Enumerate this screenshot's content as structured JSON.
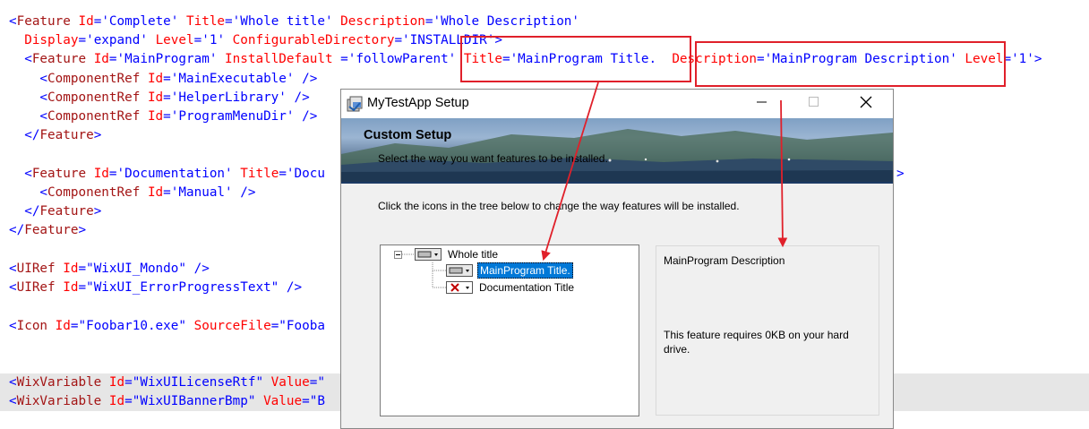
{
  "code": {
    "lines": [
      [
        [
          "punc",
          "<"
        ],
        [
          "elem",
          "Feature"
        ],
        [
          "punc",
          " "
        ],
        [
          "attr",
          "Id"
        ],
        [
          "punc",
          "="
        ],
        [
          "val",
          "'Complete'"
        ],
        [
          "punc",
          " "
        ],
        [
          "attr",
          "Title"
        ],
        [
          "punc",
          "="
        ],
        [
          "val",
          "'Whole title'"
        ],
        [
          "punc",
          " "
        ],
        [
          "attr",
          "Description"
        ],
        [
          "punc",
          "="
        ],
        [
          "val",
          "'Whole Description'"
        ]
      ],
      [
        [
          "punc",
          "  "
        ],
        [
          "attr",
          "Display"
        ],
        [
          "punc",
          "="
        ],
        [
          "val",
          "'expand'"
        ],
        [
          "punc",
          " "
        ],
        [
          "attr",
          "Level"
        ],
        [
          "punc",
          "="
        ],
        [
          "val",
          "'1'"
        ],
        [
          "punc",
          " "
        ],
        [
          "attr",
          "ConfigurableDirectory"
        ],
        [
          "punc",
          "="
        ],
        [
          "val",
          "'INSTALLDIR'"
        ],
        [
          "punc",
          ">"
        ]
      ],
      [
        [
          "punc",
          "  <"
        ],
        [
          "elem",
          "Feature"
        ],
        [
          "punc",
          " "
        ],
        [
          "attr",
          "Id"
        ],
        [
          "punc",
          "="
        ],
        [
          "val",
          "'MainProgram'"
        ],
        [
          "punc",
          " "
        ],
        [
          "attr",
          "InstallDefault"
        ],
        [
          "punc",
          " ="
        ],
        [
          "val",
          "'followParent'"
        ],
        [
          "punc",
          " "
        ],
        [
          "attr",
          "Title"
        ],
        [
          "punc",
          "="
        ],
        [
          "val",
          "'MainProgram Title."
        ],
        [
          "punc",
          "  "
        ],
        [
          "attr",
          "Description"
        ],
        [
          "punc",
          "="
        ],
        [
          "val",
          "'MainProgram Description'"
        ],
        [
          "punc",
          " "
        ],
        [
          "attr",
          "Level"
        ],
        [
          "punc",
          "="
        ],
        [
          "val",
          "'1'"
        ],
        [
          "punc",
          ">"
        ]
      ],
      [
        [
          "punc",
          "    <"
        ],
        [
          "elem",
          "ComponentRef"
        ],
        [
          "punc",
          " "
        ],
        [
          "attr",
          "Id"
        ],
        [
          "punc",
          "="
        ],
        [
          "val",
          "'MainExecutable'"
        ],
        [
          "punc",
          " />"
        ]
      ],
      [
        [
          "punc",
          "    <"
        ],
        [
          "elem",
          "ComponentRef"
        ],
        [
          "punc",
          " "
        ],
        [
          "attr",
          "Id"
        ],
        [
          "punc",
          "="
        ],
        [
          "val",
          "'HelperLibrary'"
        ],
        [
          "punc",
          " />"
        ]
      ],
      [
        [
          "punc",
          "    <"
        ],
        [
          "elem",
          "ComponentRef"
        ],
        [
          "punc",
          " "
        ],
        [
          "attr",
          "Id"
        ],
        [
          "punc",
          "="
        ],
        [
          "val",
          "'ProgramMenuDir'"
        ],
        [
          "punc",
          " />"
        ]
      ],
      [
        [
          "punc",
          "  </"
        ],
        [
          "elem",
          "Feature"
        ],
        [
          "punc",
          ">"
        ]
      ],
      [],
      [
        [
          "punc",
          "  <"
        ],
        [
          "elem",
          "Feature"
        ],
        [
          "punc",
          " "
        ],
        [
          "attr",
          "Id"
        ],
        [
          "punc",
          "="
        ],
        [
          "val",
          "'Documentation'"
        ],
        [
          "punc",
          " "
        ],
        [
          "attr",
          "Title"
        ],
        [
          "punc",
          "="
        ],
        [
          "val",
          "'Docu"
        ]
      ],
      [
        [
          "punc",
          "    <"
        ],
        [
          "elem",
          "ComponentRef"
        ],
        [
          "punc",
          " "
        ],
        [
          "attr",
          "Id"
        ],
        [
          "punc",
          "="
        ],
        [
          "val",
          "'Manual'"
        ],
        [
          "punc",
          " />"
        ]
      ],
      [
        [
          "punc",
          "  </"
        ],
        [
          "elem",
          "Feature"
        ],
        [
          "punc",
          ">"
        ]
      ],
      [
        [
          "punc",
          "</"
        ],
        [
          "elem",
          "Feature"
        ],
        [
          "punc",
          ">"
        ]
      ],
      [],
      [
        [
          "punc",
          "<"
        ],
        [
          "elem",
          "UIRef"
        ],
        [
          "punc",
          " "
        ],
        [
          "attr",
          "Id"
        ],
        [
          "punc",
          "="
        ],
        [
          "val",
          "\"WixUI_Mondo\""
        ],
        [
          "punc",
          " />"
        ]
      ],
      [
        [
          "punc",
          "<"
        ],
        [
          "elem",
          "UIRef"
        ],
        [
          "punc",
          " "
        ],
        [
          "attr",
          "Id"
        ],
        [
          "punc",
          "="
        ],
        [
          "val",
          "\"WixUI_ErrorProgressText\""
        ],
        [
          "punc",
          " />"
        ]
      ],
      [],
      [
        [
          "punc",
          "<"
        ],
        [
          "elem",
          "Icon"
        ],
        [
          "punc",
          " "
        ],
        [
          "attr",
          "Id"
        ],
        [
          "punc",
          "="
        ],
        [
          "val",
          "\"Foobar10.exe\""
        ],
        [
          "punc",
          " "
        ],
        [
          "attr",
          "SourceFile"
        ],
        [
          "punc",
          "="
        ],
        [
          "val",
          "\"Fooba"
        ]
      ],
      [],
      [],
      [
        [
          "punc",
          "<"
        ],
        [
          "elem",
          "WixVariable"
        ],
        [
          "punc",
          " "
        ],
        [
          "attr",
          "Id"
        ],
        [
          "punc",
          "="
        ],
        [
          "val",
          "\"WixUILicenseRtf\""
        ],
        [
          "punc",
          " "
        ],
        [
          "attr",
          "Value"
        ],
        [
          "punc",
          "="
        ],
        [
          "val",
          "\""
        ]
      ],
      [
        [
          "punc",
          "<"
        ],
        [
          "elem",
          "WixVariable"
        ],
        [
          "punc",
          " "
        ],
        [
          "attr",
          "Id"
        ],
        [
          "punc",
          "="
        ],
        [
          "val",
          "\"WixUIBannerBmp\""
        ],
        [
          "punc",
          " "
        ],
        [
          "attr",
          "Value"
        ],
        [
          "punc",
          "="
        ],
        [
          "val",
          "\"B"
        ]
      ]
    ],
    "documentation_line_tail": ">"
  },
  "dialog": {
    "window_title": "MyTestApp Setup",
    "banner_title": "Custom Setup",
    "banner_subtitle": "Select the way you want features to be installed.",
    "instruction": "Click the icons in the tree below to change the way features will be installed.",
    "tree": [
      {
        "label": "Whole title",
        "state": "installed",
        "selected": false
      },
      {
        "label": "MainProgram Title.",
        "state": "installed",
        "selected": true
      },
      {
        "label": "Documentation Title",
        "state": "unavailable",
        "selected": false
      }
    ],
    "description": "MainProgram Description",
    "requirement": "This feature requires 0KB on your hard drive.",
    "icons": {
      "app": "installer-icon",
      "minimize": "minimize-icon",
      "maximize": "maximize-icon",
      "close": "close-icon",
      "expand": "collapse-icon"
    }
  },
  "colors": {
    "annotation": "#e0202a",
    "selection": "#0078d7",
    "xml_element": "#a31515",
    "xml_attribute": "#ff0000",
    "xml_value": "#0000ff"
  }
}
